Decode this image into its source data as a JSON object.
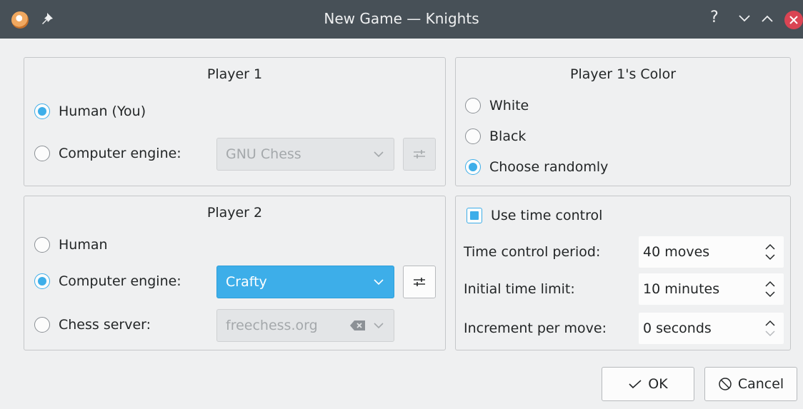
{
  "window": {
    "title": "New Game — Knights",
    "help_glyph": "?"
  },
  "player1": {
    "title": "Player 1",
    "human_label": "Human (You)",
    "engine_label": "Computer engine:",
    "engine_value": "GNU Chess",
    "selected": "human"
  },
  "player2": {
    "title": "Player 2",
    "human_label": "Human",
    "engine_label": "Computer engine:",
    "engine_value": "Crafty",
    "server_label": "Chess server:",
    "server_value": "freechess.org",
    "selected": "engine"
  },
  "color": {
    "title": "Player 1's Color",
    "options": [
      "White",
      "Black",
      "Choose randomly"
    ],
    "selected": "Choose randomly"
  },
  "time_control": {
    "checkbox_label": "Use time control",
    "checked": true,
    "period_label": "Time control period:",
    "period_value": "40 moves",
    "limit_label": "Initial time limit:",
    "limit_value": "10 minutes",
    "increment_label": "Increment per move:",
    "increment_value": "0 seconds"
  },
  "buttons": {
    "ok_label": "OK",
    "cancel_label": "Cancel"
  },
  "colors": {
    "accent": "#3daee9",
    "titlebar": "#475057",
    "close": "#da4453",
    "window_bg": "#eff0f1"
  },
  "icons": {
    "app": "knights-icon",
    "pin": "pin-icon",
    "minimize": "chevron-down-icon",
    "maximize": "chevron-up-icon",
    "close": "close-icon",
    "configure": "sliders-icon",
    "clear": "clear-text-icon",
    "ok": "checkmark-icon",
    "cancel": "cancel-icon"
  }
}
